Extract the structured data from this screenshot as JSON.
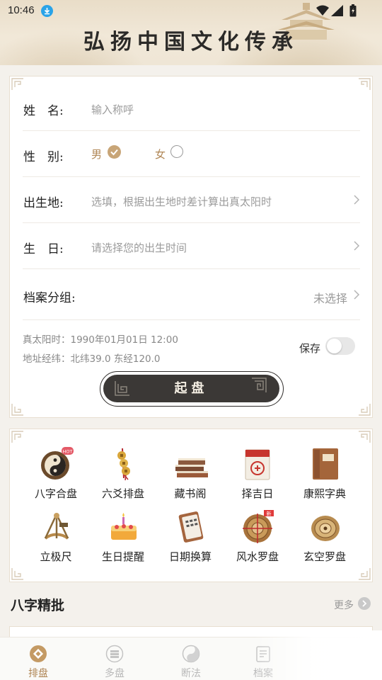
{
  "status_bar": {
    "time": "10:46"
  },
  "banner": {
    "title": "弘扬中国文化传承"
  },
  "form": {
    "name_label": "姓　名:",
    "name_placeholder": "输入称呼",
    "gender_label": "性　别:",
    "gender_male": "男",
    "gender_female": "女",
    "gender_selected": "男",
    "birthplace_label": "出生地:",
    "birthplace_hint": "选填，根据出生地时差计算出真太阳时",
    "birthday_label": "生　日:",
    "birthday_hint": "请选择您的出生时间",
    "group_label": "档案分组:",
    "group_value": "未选择",
    "solar_time": "真太阳时：1990年01月01日 12:00",
    "coordinates": "地址经纬：北纬39.0 东经120.0",
    "save_label": "保存",
    "save_enabled": false,
    "start_button": "起盘"
  },
  "tools": [
    {
      "label": "八字合盘",
      "icon": "yin-yang-icon",
      "badge": "HOT"
    },
    {
      "label": "六爻排盘",
      "icon": "coins-icon"
    },
    {
      "label": "藏书阁",
      "icon": "books-icon"
    },
    {
      "label": "择吉日",
      "icon": "calendar-icon"
    },
    {
      "label": "康熙字典",
      "icon": "dictionary-icon"
    },
    {
      "label": "立极尺",
      "icon": "sextant-icon"
    },
    {
      "label": "生日提醒",
      "icon": "cake-icon"
    },
    {
      "label": "日期换算",
      "icon": "date-calculator-icon"
    },
    {
      "label": "风水罗盘",
      "icon": "compass-icon",
      "badge": "新"
    },
    {
      "label": "玄空罗盘",
      "icon": "xuankong-compass-icon"
    }
  ],
  "section": {
    "title": "八字精批",
    "more": "更多"
  },
  "bottom_nav": [
    {
      "label": "排盘",
      "icon": "paipan-icon",
      "active": true
    },
    {
      "label": "多盘",
      "icon": "multi-chart-icon",
      "active": false
    },
    {
      "label": "断法",
      "icon": "taiji-icon",
      "active": false
    },
    {
      "label": "档案",
      "icon": "archive-icon",
      "active": false
    }
  ],
  "colors": {
    "accent": "#b08655",
    "button_dark": "#3b3836",
    "inactive": "#b9b9b9"
  }
}
